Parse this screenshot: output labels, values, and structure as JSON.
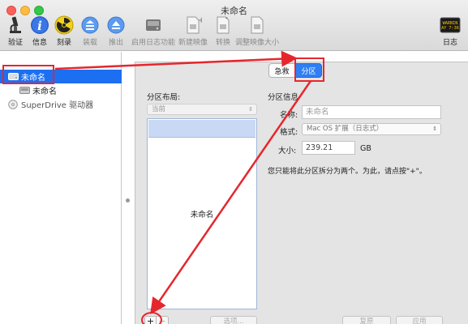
{
  "window": {
    "title": "未命名"
  },
  "toolbar": {
    "items": [
      {
        "label": "验证",
        "icon": "microscope-icon",
        "enabled": true
      },
      {
        "label": "信息",
        "icon": "info-icon",
        "enabled": true
      },
      {
        "label": "刻录",
        "icon": "radiation-icon",
        "enabled": true
      },
      {
        "label": "装载",
        "icon": "mount-icon",
        "enabled": false
      },
      {
        "label": "推出",
        "icon": "eject-icon",
        "enabled": false
      },
      {
        "label": "启用日志功能",
        "icon": "journal-icon",
        "enabled": false
      },
      {
        "label": "新建映像",
        "icon": "new-image-icon",
        "enabled": false
      },
      {
        "label": "转换",
        "icon": "convert-icon",
        "enabled": false
      },
      {
        "label": "调整映像大小",
        "icon": "resize-image-icon",
        "enabled": false
      },
      {
        "label": "日志",
        "icon": "log-icon",
        "enabled": true
      }
    ],
    "log_icon_text": [
      "WARNIN",
      "AY 7:36"
    ]
  },
  "sidebar": {
    "items": [
      {
        "label": "未命名",
        "kind": "disk",
        "selected": true
      },
      {
        "label": "未命名",
        "kind": "volume",
        "selected": false
      },
      {
        "label": "SuperDrive 驱动器",
        "kind": "optical-drive",
        "selected": false
      }
    ]
  },
  "tabs": {
    "first_aid": "急救",
    "partition": "分区",
    "active": "分区"
  },
  "partition_layout": {
    "heading": "分区布局:",
    "popup_value": "当前",
    "partition_name": "未命名"
  },
  "partition_info": {
    "heading": "分区信息",
    "name_label": "名称:",
    "name_placeholder": "未命名",
    "format_label": "格式:",
    "format_value": "Mac OS 扩展（日志式）",
    "size_label": "大小:",
    "size_value": "239.21",
    "size_unit": "GB",
    "note": "您只能将此分区拆分为两个。为此，请点按\"+\"。"
  },
  "bottom": {
    "plus": "+",
    "minus": "−",
    "options": "选项...",
    "revert": "复原",
    "apply": "应用"
  },
  "annotation_color": "#e6262d"
}
